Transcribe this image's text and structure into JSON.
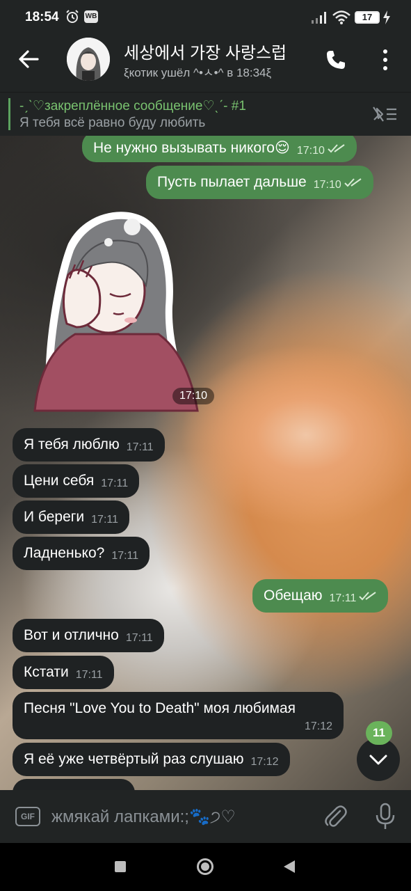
{
  "status_bar": {
    "time": "18:54",
    "wb_badge": "WB",
    "battery": "17"
  },
  "header": {
    "title": "세상에서 가장 사랑스럽",
    "status": "ξкотик ушёл ^•ㅅ•^ в 18:34ξ"
  },
  "pinned": {
    "title": "-ˏˋ♡закреплённое сообщение♡ˎˊ- #1",
    "text": "Я тебя всё равно буду любить"
  },
  "messages": [
    {
      "dir": "out",
      "text": "Не нужно вызывать никого😌",
      "time": "17:10"
    },
    {
      "dir": "out",
      "text": "Пусть пылает дальше",
      "time": "17:10"
    },
    {
      "dir": "sticker",
      "time": "17:10"
    },
    {
      "dir": "in",
      "text": "Я тебя люблю",
      "time": "17:11"
    },
    {
      "dir": "in",
      "text": "Цени себя",
      "time": "17:11"
    },
    {
      "dir": "in",
      "text": "И береги",
      "time": "17:11"
    },
    {
      "dir": "in",
      "text": "Ладненько?",
      "time": "17:11"
    },
    {
      "dir": "out",
      "text": "Обещаю",
      "time": "17:11"
    },
    {
      "dir": "in",
      "text": "Вот и отлично",
      "time": "17:11"
    },
    {
      "dir": "in",
      "text": "Кстати",
      "time": "17:11"
    },
    {
      "dir": "in",
      "text": "Песня \"Love You to Death\" моя любимая",
      "time": "17:12"
    },
    {
      "dir": "in",
      "text": "Я её уже четвёртый раз слушаю",
      "time": "17:12"
    }
  ],
  "scroll_badge": "11",
  "input": {
    "gif_label": "GIF",
    "placeholder": "жмякай лапками:;🐾੭♡"
  },
  "icons": [
    "back-arrow-icon",
    "phone-icon",
    "more-vertical-icon",
    "unpin-icon",
    "chevron-down-icon",
    "gif-icon",
    "paperclip-icon",
    "microphone-icon",
    "alarm-icon",
    "signal-icon",
    "wifi-icon",
    "battery-icon",
    "charging-bolt-icon"
  ],
  "colors": {
    "outgoing_bubble": "#4d8b4f",
    "incoming_bubble": "#1f2223",
    "accent_green": "#6ab35b",
    "header_bg": "#212424"
  }
}
